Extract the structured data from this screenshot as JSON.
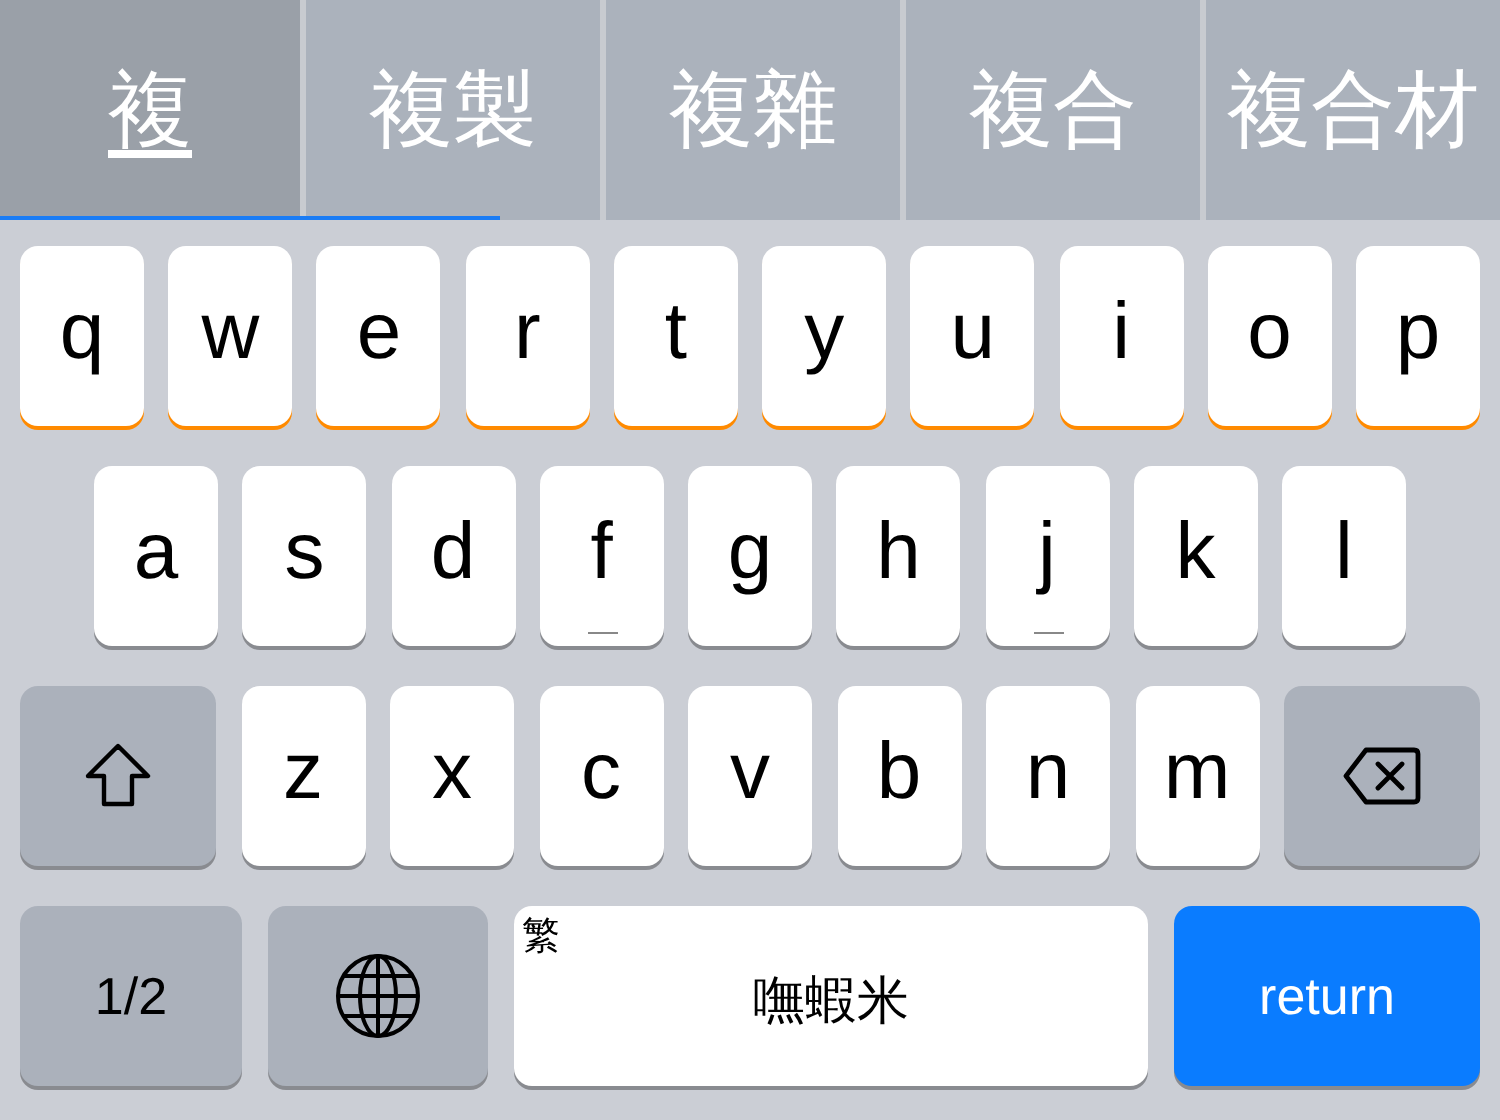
{
  "candidates": [
    {
      "text": "複",
      "selected": true
    },
    {
      "text": "複製",
      "selected": false
    },
    {
      "text": "複雜",
      "selected": false
    },
    {
      "text": "複合",
      "selected": false
    },
    {
      "text": "複合材",
      "selected": false
    }
  ],
  "rows": [
    {
      "keys": [
        {
          "kind": "letter",
          "label": "q",
          "highlighted": true,
          "homing": false
        },
        {
          "kind": "letter",
          "label": "w",
          "highlighted": true,
          "homing": false
        },
        {
          "kind": "letter",
          "label": "e",
          "highlighted": true,
          "homing": false
        },
        {
          "kind": "letter",
          "label": "r",
          "highlighted": true,
          "homing": false
        },
        {
          "kind": "letter",
          "label": "t",
          "highlighted": true,
          "homing": false
        },
        {
          "kind": "letter",
          "label": "y",
          "highlighted": true,
          "homing": false
        },
        {
          "kind": "letter",
          "label": "u",
          "highlighted": true,
          "homing": false
        },
        {
          "kind": "letter",
          "label": "i",
          "highlighted": true,
          "homing": false
        },
        {
          "kind": "letter",
          "label": "o",
          "highlighted": true,
          "homing": false
        },
        {
          "kind": "letter",
          "label": "p",
          "highlighted": true,
          "homing": false
        }
      ]
    },
    {
      "keys": [
        {
          "kind": "letter",
          "label": "a",
          "highlighted": false,
          "homing": false
        },
        {
          "kind": "letter",
          "label": "s",
          "highlighted": false,
          "homing": false
        },
        {
          "kind": "letter",
          "label": "d",
          "highlighted": false,
          "homing": false
        },
        {
          "kind": "letter",
          "label": "f",
          "highlighted": false,
          "homing": true
        },
        {
          "kind": "letter",
          "label": "g",
          "highlighted": false,
          "homing": false
        },
        {
          "kind": "letter",
          "label": "h",
          "highlighted": false,
          "homing": false
        },
        {
          "kind": "letter",
          "label": "j",
          "highlighted": false,
          "homing": true
        },
        {
          "kind": "letter",
          "label": "k",
          "highlighted": false,
          "homing": false
        },
        {
          "kind": "letter",
          "label": "l",
          "highlighted": false,
          "homing": false
        }
      ]
    },
    {
      "keys": [
        {
          "kind": "shift"
        },
        {
          "kind": "letter",
          "label": "z",
          "highlighted": false,
          "homing": false
        },
        {
          "kind": "letter",
          "label": "x",
          "highlighted": false,
          "homing": false
        },
        {
          "kind": "letter",
          "label": "c",
          "highlighted": false,
          "homing": false
        },
        {
          "kind": "letter",
          "label": "v",
          "highlighted": false,
          "homing": false
        },
        {
          "kind": "letter",
          "label": "b",
          "highlighted": false,
          "homing": false
        },
        {
          "kind": "letter",
          "label": "n",
          "highlighted": false,
          "homing": false
        },
        {
          "kind": "letter",
          "label": "m",
          "highlighted": false,
          "homing": false
        },
        {
          "kind": "delete"
        }
      ]
    },
    {
      "keys": [
        {
          "kind": "mode",
          "label": "1/2"
        },
        {
          "kind": "globe"
        },
        {
          "kind": "space",
          "label": "嘸蝦米",
          "badge": "繁"
        },
        {
          "kind": "return",
          "label": "return"
        }
      ]
    }
  ]
}
